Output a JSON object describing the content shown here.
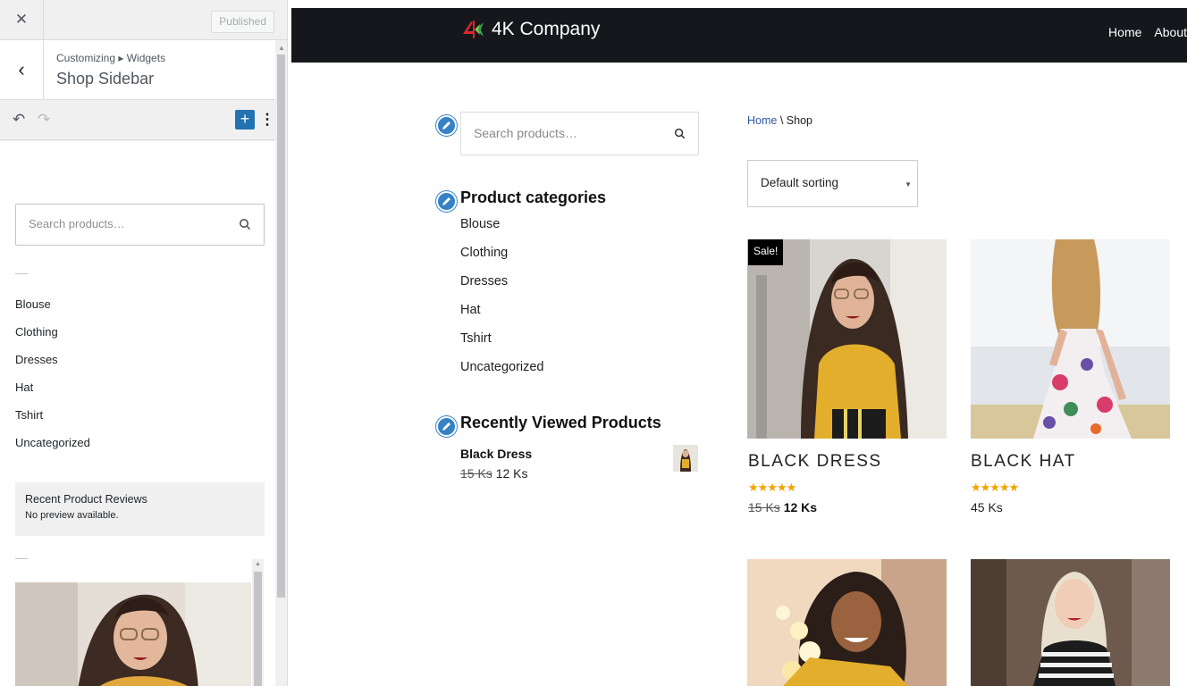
{
  "customizer": {
    "published_label": "Published",
    "breadcrumb": "Customizing ▸ Widgets",
    "section_title": "Shop Sidebar",
    "search_placeholder": "Search products…",
    "categories": [
      "Blouse",
      "Clothing",
      "Dresses",
      "Hat",
      "Tshirt",
      "Uncategorized"
    ],
    "reviews_title": "Recent Product Reviews",
    "reviews_note": "No preview available."
  },
  "site": {
    "title": "4K Company",
    "nav": [
      "Home",
      "About"
    ],
    "search_placeholder": "Search products…",
    "categories_title": "Product categories",
    "categories": [
      "Blouse",
      "Clothing",
      "Dresses",
      "Hat",
      "Tshirt",
      "Uncategorized"
    ],
    "recent_title": "Recently Viewed Products",
    "recent_item": {
      "name": "Black Dress",
      "old_price": "15 Ks",
      "price": "12 Ks"
    },
    "breadcrumb": {
      "home": "Home",
      "sep": "\\",
      "current": "Shop"
    },
    "sorting": "Default sorting",
    "products": [
      {
        "name": "BLACK DRESS",
        "sale": "Sale!",
        "rating": 5,
        "old_price": "15 Ks",
        "price": "12 Ks"
      },
      {
        "name": "BLACK HAT",
        "rating": 5,
        "price": "45 Ks"
      }
    ]
  },
  "colors": {
    "header_bg": "#15171c",
    "accent": "#2271b1",
    "stars": "#f2a300",
    "link": "#2e57a6"
  }
}
